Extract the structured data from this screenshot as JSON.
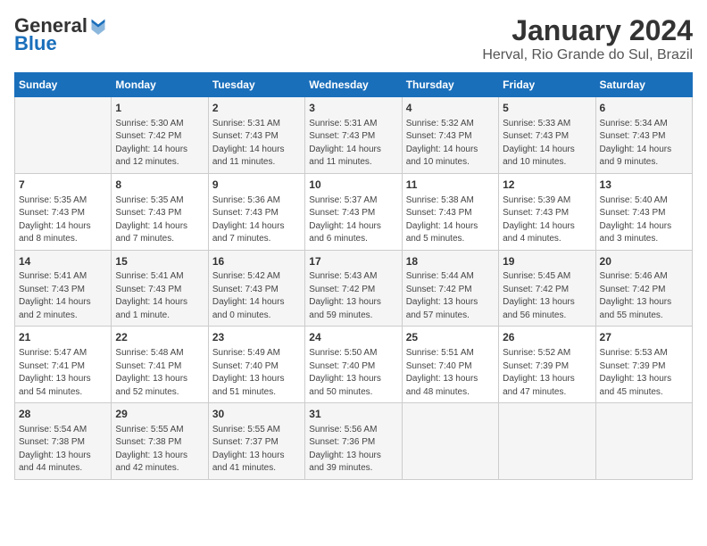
{
  "logo": {
    "general": "General",
    "blue": "Blue"
  },
  "title": "January 2024",
  "subtitle": "Herval, Rio Grande do Sul, Brazil",
  "weekdays": [
    "Sunday",
    "Monday",
    "Tuesday",
    "Wednesday",
    "Thursday",
    "Friday",
    "Saturday"
  ],
  "weeks": [
    [
      {
        "day": "",
        "info": ""
      },
      {
        "day": "1",
        "info": "Sunrise: 5:30 AM\nSunset: 7:42 PM\nDaylight: 14 hours\nand 12 minutes."
      },
      {
        "day": "2",
        "info": "Sunrise: 5:31 AM\nSunset: 7:43 PM\nDaylight: 14 hours\nand 11 minutes."
      },
      {
        "day": "3",
        "info": "Sunrise: 5:31 AM\nSunset: 7:43 PM\nDaylight: 14 hours\nand 11 minutes."
      },
      {
        "day": "4",
        "info": "Sunrise: 5:32 AM\nSunset: 7:43 PM\nDaylight: 14 hours\nand 10 minutes."
      },
      {
        "day": "5",
        "info": "Sunrise: 5:33 AM\nSunset: 7:43 PM\nDaylight: 14 hours\nand 10 minutes."
      },
      {
        "day": "6",
        "info": "Sunrise: 5:34 AM\nSunset: 7:43 PM\nDaylight: 14 hours\nand 9 minutes."
      }
    ],
    [
      {
        "day": "7",
        "info": "Sunrise: 5:35 AM\nSunset: 7:43 PM\nDaylight: 14 hours\nand 8 minutes."
      },
      {
        "day": "8",
        "info": "Sunrise: 5:35 AM\nSunset: 7:43 PM\nDaylight: 14 hours\nand 7 minutes."
      },
      {
        "day": "9",
        "info": "Sunrise: 5:36 AM\nSunset: 7:43 PM\nDaylight: 14 hours\nand 7 minutes."
      },
      {
        "day": "10",
        "info": "Sunrise: 5:37 AM\nSunset: 7:43 PM\nDaylight: 14 hours\nand 6 minutes."
      },
      {
        "day": "11",
        "info": "Sunrise: 5:38 AM\nSunset: 7:43 PM\nDaylight: 14 hours\nand 5 minutes."
      },
      {
        "day": "12",
        "info": "Sunrise: 5:39 AM\nSunset: 7:43 PM\nDaylight: 14 hours\nand 4 minutes."
      },
      {
        "day": "13",
        "info": "Sunrise: 5:40 AM\nSunset: 7:43 PM\nDaylight: 14 hours\nand 3 minutes."
      }
    ],
    [
      {
        "day": "14",
        "info": "Sunrise: 5:41 AM\nSunset: 7:43 PM\nDaylight: 14 hours\nand 2 minutes."
      },
      {
        "day": "15",
        "info": "Sunrise: 5:41 AM\nSunset: 7:43 PM\nDaylight: 14 hours\nand 1 minute."
      },
      {
        "day": "16",
        "info": "Sunrise: 5:42 AM\nSunset: 7:43 PM\nDaylight: 14 hours\nand 0 minutes."
      },
      {
        "day": "17",
        "info": "Sunrise: 5:43 AM\nSunset: 7:42 PM\nDaylight: 13 hours\nand 59 minutes."
      },
      {
        "day": "18",
        "info": "Sunrise: 5:44 AM\nSunset: 7:42 PM\nDaylight: 13 hours\nand 57 minutes."
      },
      {
        "day": "19",
        "info": "Sunrise: 5:45 AM\nSunset: 7:42 PM\nDaylight: 13 hours\nand 56 minutes."
      },
      {
        "day": "20",
        "info": "Sunrise: 5:46 AM\nSunset: 7:42 PM\nDaylight: 13 hours\nand 55 minutes."
      }
    ],
    [
      {
        "day": "21",
        "info": "Sunrise: 5:47 AM\nSunset: 7:41 PM\nDaylight: 13 hours\nand 54 minutes."
      },
      {
        "day": "22",
        "info": "Sunrise: 5:48 AM\nSunset: 7:41 PM\nDaylight: 13 hours\nand 52 minutes."
      },
      {
        "day": "23",
        "info": "Sunrise: 5:49 AM\nSunset: 7:40 PM\nDaylight: 13 hours\nand 51 minutes."
      },
      {
        "day": "24",
        "info": "Sunrise: 5:50 AM\nSunset: 7:40 PM\nDaylight: 13 hours\nand 50 minutes."
      },
      {
        "day": "25",
        "info": "Sunrise: 5:51 AM\nSunset: 7:40 PM\nDaylight: 13 hours\nand 48 minutes."
      },
      {
        "day": "26",
        "info": "Sunrise: 5:52 AM\nSunset: 7:39 PM\nDaylight: 13 hours\nand 47 minutes."
      },
      {
        "day": "27",
        "info": "Sunrise: 5:53 AM\nSunset: 7:39 PM\nDaylight: 13 hours\nand 45 minutes."
      }
    ],
    [
      {
        "day": "28",
        "info": "Sunrise: 5:54 AM\nSunset: 7:38 PM\nDaylight: 13 hours\nand 44 minutes."
      },
      {
        "day": "29",
        "info": "Sunrise: 5:55 AM\nSunset: 7:38 PM\nDaylight: 13 hours\nand 42 minutes."
      },
      {
        "day": "30",
        "info": "Sunrise: 5:55 AM\nSunset: 7:37 PM\nDaylight: 13 hours\nand 41 minutes."
      },
      {
        "day": "31",
        "info": "Sunrise: 5:56 AM\nSunset: 7:36 PM\nDaylight: 13 hours\nand 39 minutes."
      },
      {
        "day": "",
        "info": ""
      },
      {
        "day": "",
        "info": ""
      },
      {
        "day": "",
        "info": ""
      }
    ]
  ]
}
